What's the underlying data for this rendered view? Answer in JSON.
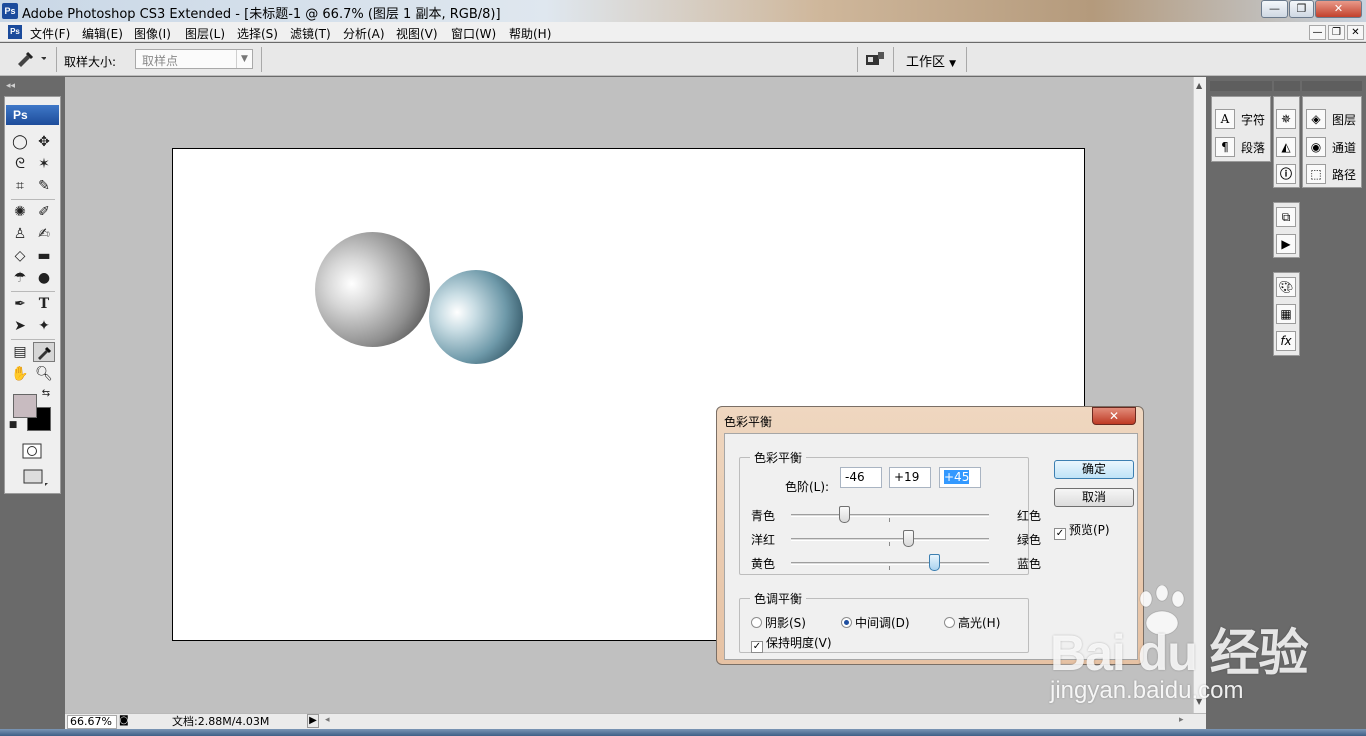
{
  "window": {
    "title": "Adobe Photoshop CS3 Extended - [未标题-1 @ 66.7% (图层 1 副本, RGB/8)]",
    "controls": {
      "minimize": "—",
      "maximize": "❐",
      "close": "✕"
    }
  },
  "menu": {
    "items": [
      "文件(F)",
      "编辑(E)",
      "图像(I)",
      "图层(L)",
      "选择(S)",
      "滤镜(T)",
      "分析(A)",
      "视图(V)",
      "窗口(W)",
      "帮助(H)"
    ],
    "doc_controls": [
      "—",
      "❐",
      "✕"
    ]
  },
  "options_bar": {
    "sample_size_label": "取样大小:",
    "sample_size_value": "取样点",
    "workspace_label": "工作区"
  },
  "toolbox": {
    "header": "Ps",
    "foreground_color": "#c8bbc0",
    "background_color": "#000000"
  },
  "panels": {
    "character_label": "字符",
    "paragraph_label": "段落",
    "layers_label": "图层",
    "channels_label": "通道",
    "paths_label": "路径"
  },
  "status_bar": {
    "zoom": "66.67%",
    "doc_info": "文档:2.88M/4.03M"
  },
  "dialog": {
    "title": "色彩平衡",
    "color_balance_group": "色彩平衡",
    "levels_label": "色阶(L):",
    "levels": [
      "-46",
      "+19",
      "+45"
    ],
    "sliders": [
      {
        "left": "青色",
        "right": "红色",
        "value": -46
      },
      {
        "left": "洋红",
        "right": "绿色",
        "value": 19
      },
      {
        "left": "黄色",
        "right": "蓝色",
        "value": 45
      }
    ],
    "tone_balance_group": "色调平衡",
    "tone_options": [
      "阴影(S)",
      "中间调(D)",
      "高光(H)"
    ],
    "tone_selected": "中间调(D)",
    "preserve_luminosity_label": "保持明度(V)",
    "preserve_luminosity": true,
    "ok_label": "确定",
    "cancel_label": "取消",
    "preview_label": "预览(P)",
    "preview": true
  },
  "watermark": {
    "brand": "Bai du 经验",
    "url": "jingyan.baidu.com"
  }
}
